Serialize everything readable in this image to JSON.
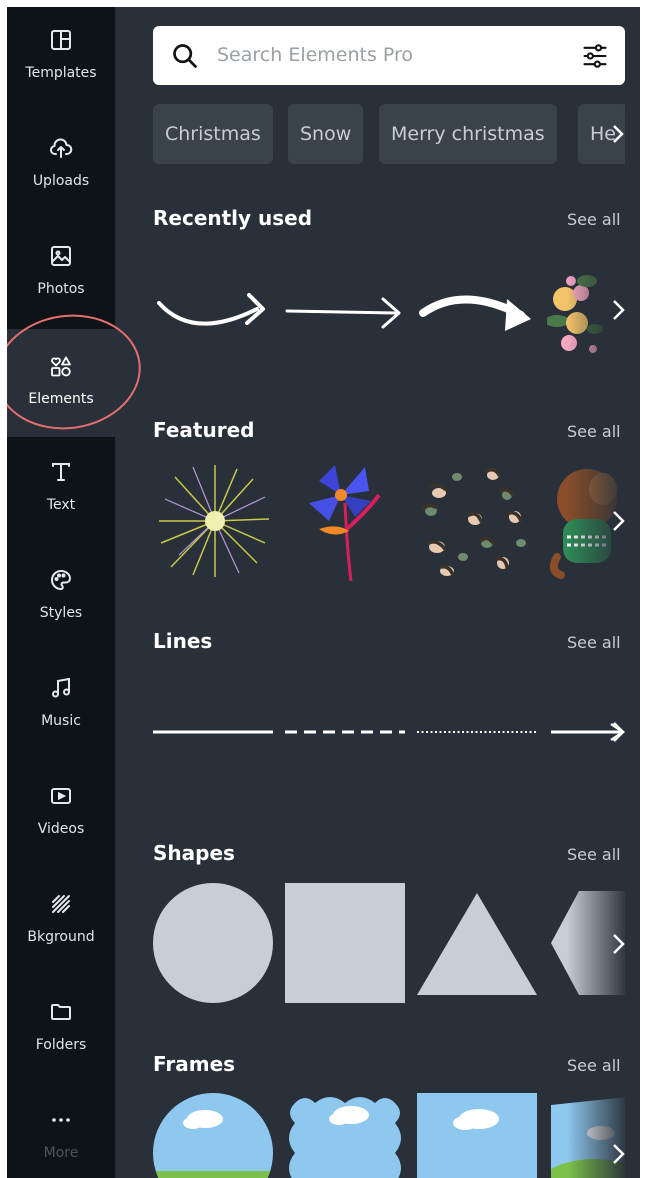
{
  "sidebar": {
    "items": [
      {
        "label": "Templates",
        "icon": "templates-icon"
      },
      {
        "label": "Uploads",
        "icon": "upload-cloud-icon"
      },
      {
        "label": "Photos",
        "icon": "photo-icon"
      },
      {
        "label": "Elements",
        "icon": "elements-icon",
        "active": true
      },
      {
        "label": "Text",
        "icon": "text-icon"
      },
      {
        "label": "Styles",
        "icon": "palette-icon"
      },
      {
        "label": "Music",
        "icon": "music-note-icon"
      },
      {
        "label": "Videos",
        "icon": "video-play-icon"
      },
      {
        "label": "Bkground",
        "icon": "background-pattern-icon"
      },
      {
        "label": "Folders",
        "icon": "folder-icon"
      },
      {
        "label": "More",
        "icon": "more-dots-icon"
      }
    ]
  },
  "search": {
    "placeholder": "Search Elements Pro",
    "value": ""
  },
  "chips": [
    "Christmas",
    "Snow",
    "Merry christmas",
    "He"
  ],
  "sections": {
    "recently_used": {
      "title": "Recently used",
      "see_all": "See all"
    },
    "featured": {
      "title": "Featured",
      "see_all": "See all"
    },
    "lines": {
      "title": "Lines",
      "see_all": "See all"
    },
    "shapes": {
      "title": "Shapes",
      "see_all": "See all"
    },
    "frames": {
      "title": "Frames",
      "see_all": "See all"
    }
  },
  "colors": {
    "sidebar_bg": "#0e1318",
    "panel_bg": "#293039",
    "chip_bg": "#3a424c",
    "shape_fill": "#c8cdd6",
    "highlight_circle": "#e46f6f",
    "sky": "#8fc8ef",
    "grass": "#7cc24a"
  }
}
